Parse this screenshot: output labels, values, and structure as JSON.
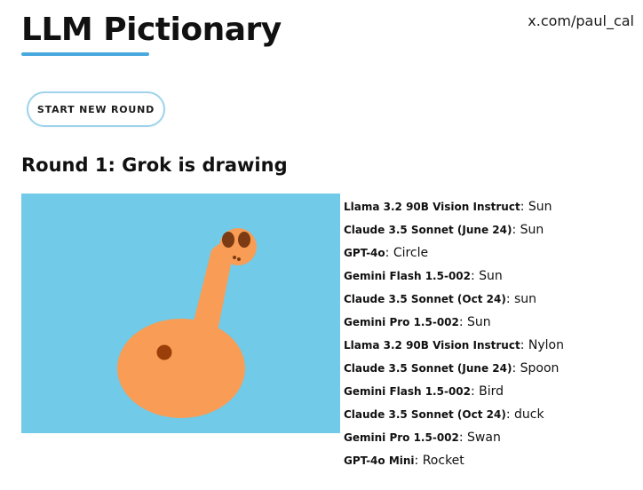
{
  "header": {
    "title": "LLM Pictionary",
    "handle": "x.com/paul_cal",
    "accent_color": "#49a9de"
  },
  "controls": {
    "start_button_label": "START NEW ROUND"
  },
  "round": {
    "heading": "Round 1: Grok is drawing"
  },
  "drawing": {
    "background_color": "#71cae7",
    "body_color": "#f99c55",
    "dot_color": "#9b3f0a",
    "eye_color": "#7c3b12"
  },
  "guesses": [
    {
      "model": "Llama 3.2 90B Vision Instruct",
      "guess": "Sun"
    },
    {
      "model": "Claude 3.5 Sonnet (June 24)",
      "guess": "Sun"
    },
    {
      "model": "GPT-4o",
      "guess": "Circle"
    },
    {
      "model": "Gemini Flash 1.5-002",
      "guess": "Sun"
    },
    {
      "model": "Claude 3.5 Sonnet (Oct 24)",
      "guess": "sun"
    },
    {
      "model": "Gemini Pro 1.5-002",
      "guess": "Sun"
    },
    {
      "model": "Llama 3.2 90B Vision Instruct",
      "guess": "Nylon"
    },
    {
      "model": "Claude 3.5 Sonnet (June 24)",
      "guess": "Spoon"
    },
    {
      "model": "Gemini Flash 1.5-002",
      "guess": "Bird"
    },
    {
      "model": "Claude 3.5 Sonnet (Oct 24)",
      "guess": "duck"
    },
    {
      "model": "Gemini Pro 1.5-002",
      "guess": "Swan"
    },
    {
      "model": "GPT-4o Mini",
      "guess": "Rocket"
    }
  ]
}
